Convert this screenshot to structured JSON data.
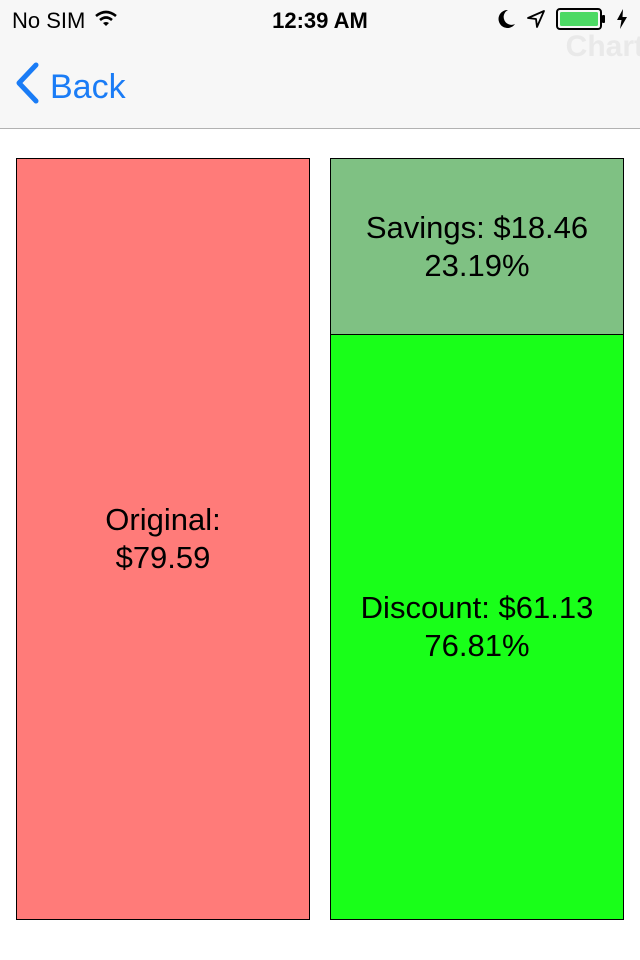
{
  "status_bar": {
    "carrier": "No SIM",
    "time": "12:39 AM",
    "icons": [
      "wifi-icon",
      "moon-icon",
      "location-arrow-icon",
      "battery-icon",
      "charging-bolt-icon"
    ]
  },
  "nav_bar": {
    "back_label": "Back",
    "title": "Chart"
  },
  "colors": {
    "original": "#ff7b79",
    "savings": "#7fc183",
    "discount": "#19ff19",
    "tint": "#1a7cf6"
  },
  "chart_data": {
    "type": "bar",
    "bars": [
      {
        "name": "original",
        "label": "Original:",
        "value_text": "$79.59",
        "value": 79.59
      },
      {
        "name": "savings",
        "label": "Savings: $18.46",
        "percent_text": "23.19%",
        "value": 18.46,
        "percent": 23.19
      },
      {
        "name": "discount",
        "label": "Discount: $61.13",
        "percent_text": "76.81%",
        "value": 61.13,
        "percent": 76.81
      }
    ]
  }
}
